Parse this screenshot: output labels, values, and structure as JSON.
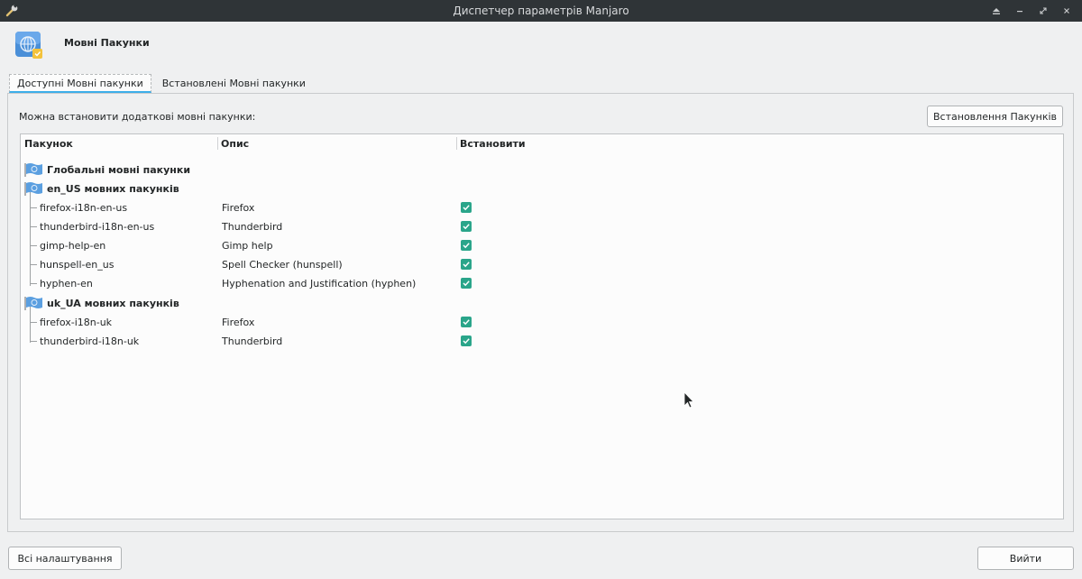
{
  "window": {
    "title": "Диспетчер параметрів Manjaro",
    "icon": "wrench-icon",
    "controls": [
      "keep-above-icon",
      "minimize-icon",
      "restore-icon",
      "close-icon"
    ]
  },
  "header": {
    "icon": "language-packages-icon",
    "title": "Мовні Пакунки"
  },
  "tabs": [
    {
      "label": "Доступні Мовні пакунки",
      "active": true
    },
    {
      "label": "Встановлені Мовні пакунки",
      "active": false
    }
  ],
  "panel": {
    "description": "Можна встановити додаткові мовні пакунки:",
    "install_button": "Встановлення Пакунків"
  },
  "tree": {
    "columns": [
      "Пакунок",
      "Опис",
      "Встановити"
    ],
    "groups": [
      {
        "label": "Глобальні мовні пакунки",
        "items": []
      },
      {
        "label": "en_US мовних пакунків",
        "items": [
          {
            "name": "firefox-i18n-en-us",
            "desc": "Firefox",
            "checked": true
          },
          {
            "name": "thunderbird-i18n-en-us",
            "desc": "Thunderbird",
            "checked": true
          },
          {
            "name": "gimp-help-en",
            "desc": "Gimp help",
            "checked": true
          },
          {
            "name": "hunspell-en_us",
            "desc": "Spell Checker (hunspell)",
            "checked": true
          },
          {
            "name": "hyphen-en",
            "desc": "Hyphenation and Justification (hyphen)",
            "checked": true
          }
        ]
      },
      {
        "label": "uk_UA мовних пакунків",
        "items": [
          {
            "name": "firefox-i18n-uk",
            "desc": "Firefox",
            "checked": true
          },
          {
            "name": "thunderbird-i18n-uk",
            "desc": "Thunderbird",
            "checked": true
          }
        ]
      }
    ]
  },
  "footer": {
    "all_settings": "Всі налаштування",
    "quit": "Вийти"
  },
  "colors": {
    "accent": "#3daee9",
    "check": "#2aa58a",
    "titlebar": "#2f3437"
  }
}
